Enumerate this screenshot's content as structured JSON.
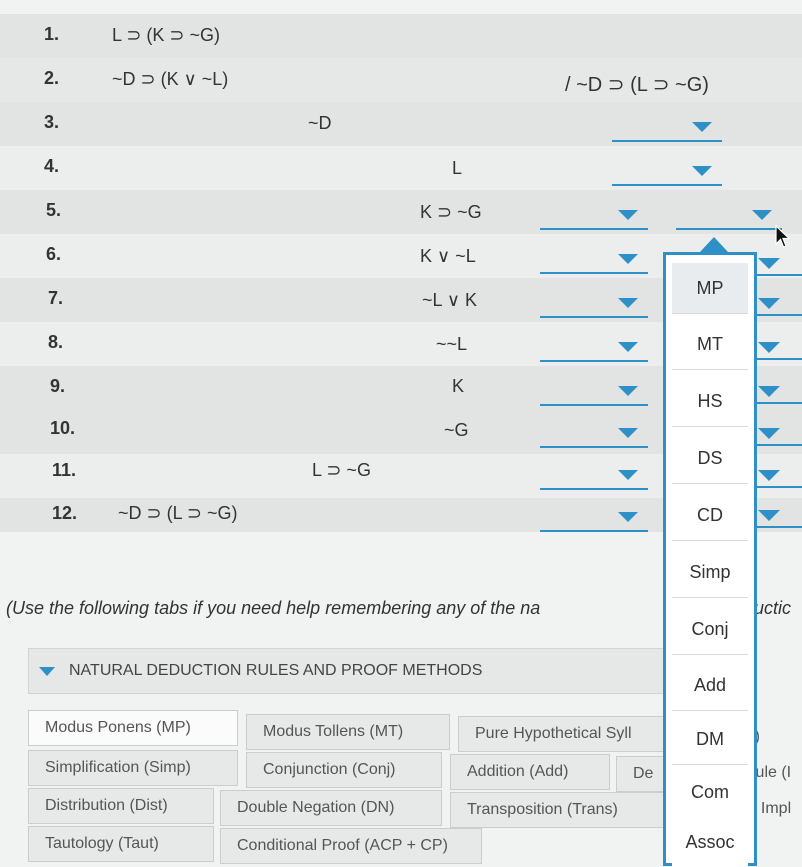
{
  "proof": {
    "conclusion": "/ ~D ⊃ (L ⊃ ~G)",
    "lines": [
      {
        "num": "1.",
        "formula": "L ⊃ (K ⊃ ~G)"
      },
      {
        "num": "2.",
        "formula": "~D ⊃ (K ∨ ~L)"
      },
      {
        "num": "3.",
        "formula": "~D"
      },
      {
        "num": "4.",
        "formula": "L"
      },
      {
        "num": "5.",
        "formula": "K ⊃ ~G"
      },
      {
        "num": "6.",
        "formula": "K ∨ ~L"
      },
      {
        "num": "7.",
        "formula": "~L ∨ K"
      },
      {
        "num": "8.",
        "formula": "~~L"
      },
      {
        "num": "9.",
        "formula": "K"
      },
      {
        "num": "10.",
        "formula": "~G"
      },
      {
        "num": "11.",
        "formula": "L ⊃ ~G"
      },
      {
        "num": "12.",
        "formula": "~D ⊃ (L ⊃ ~G)"
      }
    ]
  },
  "rule_menu": {
    "open": true,
    "options": [
      "MP",
      "MT",
      "HS",
      "DS",
      "CD",
      "Simp",
      "Conj",
      "Add",
      "DM",
      "Com",
      "Assoc"
    ],
    "highlighted": "MP"
  },
  "help": {
    "note": "(Use the following tabs if you need help remembering any of the na",
    "note_tail": "ductic",
    "accordion_title": "NATURAL DEDUCTION RULES AND PROOF METHODS",
    "tabs": [
      {
        "label": "Modus Ponens (MP)"
      },
      {
        "label": "Modus Tollens (MT)"
      },
      {
        "label": "Pure Hypothetical Syll"
      },
      {
        "label": "Simplification (Simp)"
      },
      {
        "label": "Conjunction (Conj)"
      },
      {
        "label": "Addition (Add)"
      },
      {
        "label": "De"
      },
      {
        "label": "Distribution (Dist)"
      },
      {
        "label": "Double Negation (DN)"
      },
      {
        "label": "Transposition (Trans)"
      },
      {
        "label": "Tautology (Taut)"
      },
      {
        "label": "Conditional Proof (ACP + CP)"
      }
    ],
    "fragments": [
      "S)",
      "Rule (I",
      "al Impl"
    ]
  },
  "colors": {
    "accent": "#2f8fc7",
    "row_shade": "#e2e4e4",
    "background": "#f1f2f2"
  }
}
